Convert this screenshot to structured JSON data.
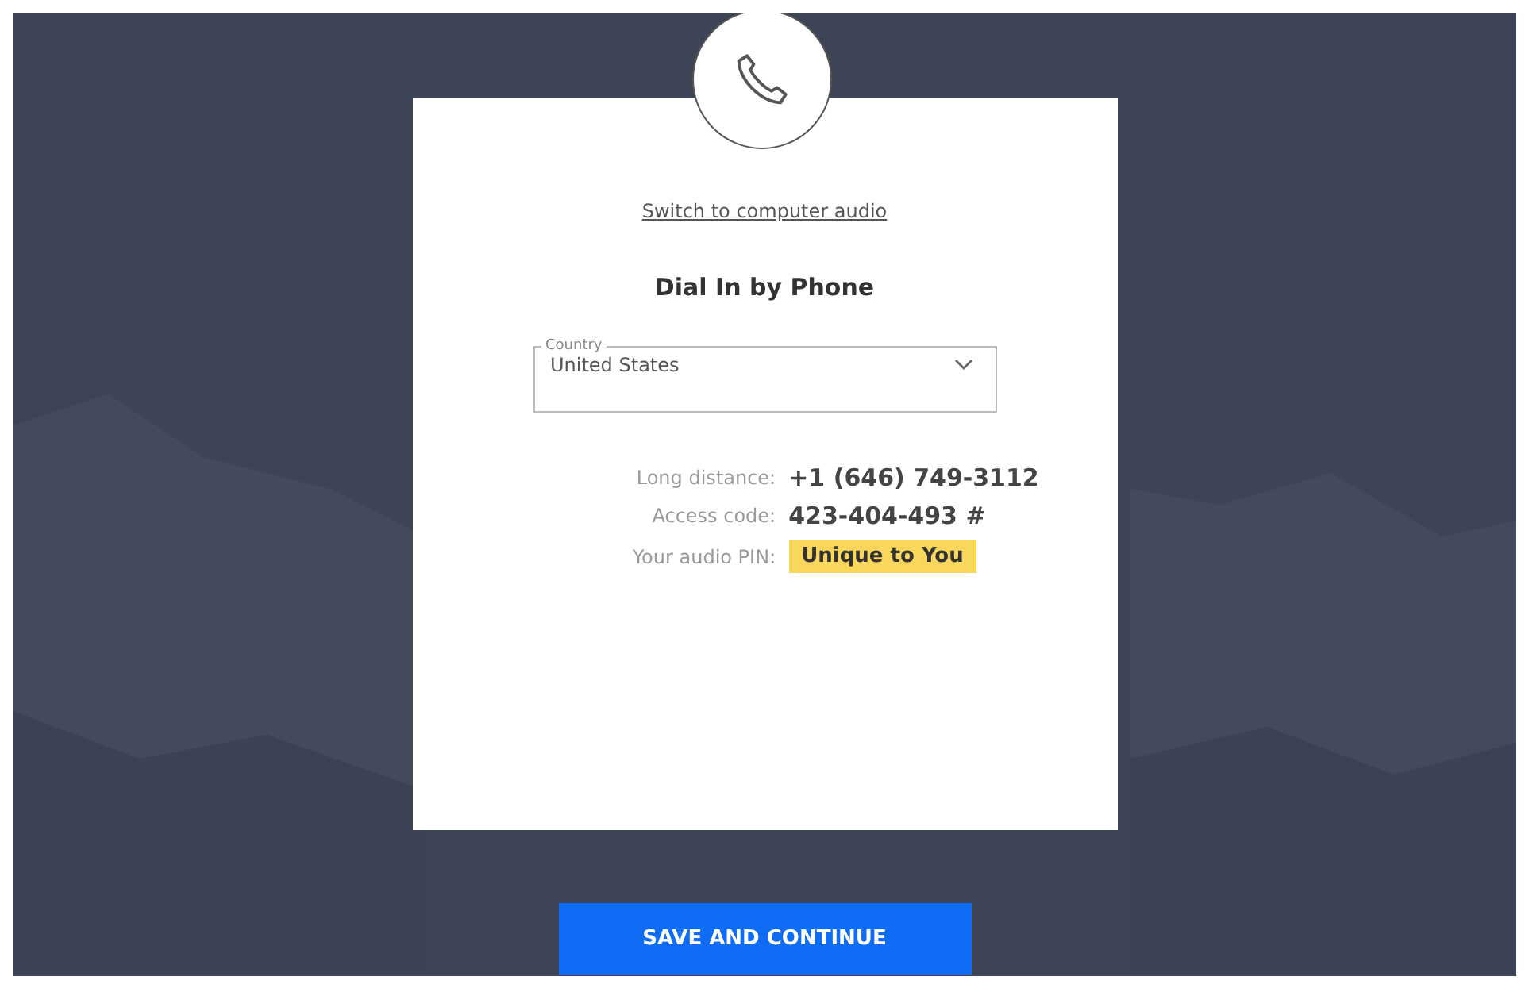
{
  "dialog": {
    "link": "Switch to computer audio",
    "title": "Dial In by Phone",
    "country_field": {
      "label": "Country",
      "value": "United States"
    },
    "details": [
      {
        "label": "Long distance:",
        "value": "+1 (646) 749-3112",
        "highlighted": false
      },
      {
        "label": "Access code:",
        "value": "423-404-493 #",
        "highlighted": false
      },
      {
        "label": "Your audio PIN:",
        "value": "Unique to You",
        "highlighted": true
      }
    ]
  },
  "primary_button": "SAVE AND CONTINUE"
}
